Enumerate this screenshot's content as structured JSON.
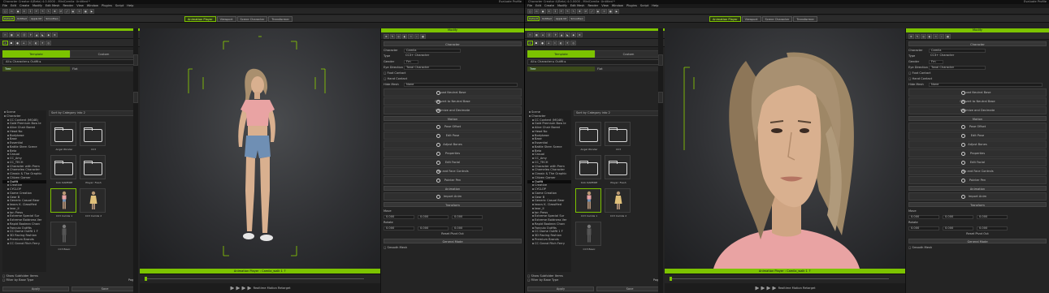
{
  "left": {
    "title": "Character Creator 4(Beta) 4.0.0000 - MiniCamila: Untitled *",
    "title_right": "Evaluate Profile",
    "menus": [
      "File",
      "Edit",
      "Create",
      "Modify",
      "Edit Mesh",
      "Render",
      "View",
      "Window",
      "Plugins",
      "Script",
      "Help"
    ],
    "toolbar2_left": [
      "Default",
      "Untitled",
      "Apple Kit",
      "Smoothen"
    ],
    "tabs": [
      "Animation Player",
      "Viewport",
      "Scene Character",
      "Transformer"
    ],
    "content_panel_title": "Content",
    "content_tabs": [
      "Template",
      "Custom"
    ],
    "path": "All ▸ Character ▸ Outfit ▸",
    "tree_tabs": [
      "Tree",
      "Flat"
    ],
    "sort_label": "Sort by Category into 2",
    "tree_items": [
      "Scene",
      "Character",
      "CC Content (MG48)",
      "Gold Premium Bow Ie",
      "Alice Chair Bored",
      "Head No",
      "Bodybase",
      "Base",
      "Essential",
      "Battle Stern Scene",
      "Beta",
      "Casual",
      "CC_Amy",
      "CC_TECH",
      "Character with Prem",
      "Chameleo Character",
      "Classic & The Graphic",
      "Citizen Gamer",
      "Outfit",
      "Creative",
      "CYCLOP",
      "Game Creation",
      "Gear B",
      "Generic Casual Bear",
      "Iwocs K. Classified",
      "Iwor_II",
      "Ion Press",
      "Extreme Special Sur",
      "Extreme Boldness Ver",
      "Rapid Boolean Charc",
      "Fancuio Outfits",
      "CC Dome Outfit 1 F",
      "3D Racing Fashion",
      "Premium Brands",
      "CC Grand Fitch Ferry"
    ],
    "tree_selected": "Outfit",
    "thumbs": [
      "Angel Wonder",
      "CC3",
      "Kick DAMMIM",
      "Player: Fresh",
      "CC3 Camila 1",
      "CC3 Camila 2",
      "CC3 Basic"
    ],
    "show_subfolder": "Show Subfolder Items",
    "filter_type": "Filter by Base Type",
    "page": "Page 1",
    "bottom_buttons": [
      "Apply",
      "Save"
    ],
    "timeline_label": "Animation Player : Camila_walk 1 ↑",
    "playbar_label": "Realtime",
    "playbar_extra": [
      "Motion",
      "Retarget"
    ],
    "modify_title": "Modify",
    "sections": {
      "character": "Character",
      "morphs": "Morphs",
      "motion": "Motion",
      "animation": "Animation",
      "transform": "Transform",
      "general": "General Mode"
    },
    "props": [
      {
        "label": "Character",
        "value": "Camila"
      },
      {
        "label": "Type",
        "value": "CC3+ Character"
      },
      {
        "label": "Gender",
        "value": "Fm"
      }
    ],
    "eye_label": "Eye Direction",
    "eye_value": "Tonal Character",
    "checks": [
      "Foot Contact",
      "Hand Contact"
    ],
    "hide_label": "Hide Mesh",
    "hide_value": "None",
    "buttons_top": [
      "Load Neutral Base",
      "Convert to Neutral Base",
      "Optimize and Decimate"
    ],
    "buttons_motion": [
      "Pose Offset",
      "Edit Pose",
      "Adjust Bones",
      "Properties",
      "Edit Facial",
      "Hip and Face Controls",
      "Pointer Pen"
    ],
    "button_anim": "Import Anim",
    "move_label": "Move",
    "rotate_label": "Rotate",
    "xyz_move": [
      "0.000",
      "0.000",
      "0.000"
    ],
    "xyz_rot": [
      "0.000",
      "0.000",
      "0.000"
    ],
    "reset_label": "Reset Pivot Out",
    "smooth_label": "Smooth Mesh"
  },
  "right": {
    "title": "Character Creator 4(Beta) 4.0.0000 - MiniCamila: Untitled *",
    "title_right": "Evaluate Profile",
    "menus": [
      "File",
      "Edit",
      "Create",
      "Modify",
      "Edit Mesh",
      "Render",
      "View",
      "Window",
      "Plugins",
      "Script",
      "Help"
    ],
    "tabs": [
      "Animation Player",
      "Viewport",
      "Scene Character",
      "Transformer"
    ],
    "timeline_label": "Animation Player : Camila_walk 1 ↑",
    "playbar_label": "Realtime",
    "playbar_extra": [
      "Motion",
      "Retarget"
    ]
  },
  "colors": {
    "accent": "#7cc300",
    "panel": "#242424",
    "shirt": "#e9a3a3",
    "hair": "#9b8566",
    "skin": "#d9b08f",
    "shorts": "#6f8fb4"
  },
  "icons": [
    "folder-icon",
    "play-icon",
    "gear-icon",
    "search-icon",
    "avatar-icon",
    "arrow-icon"
  ]
}
